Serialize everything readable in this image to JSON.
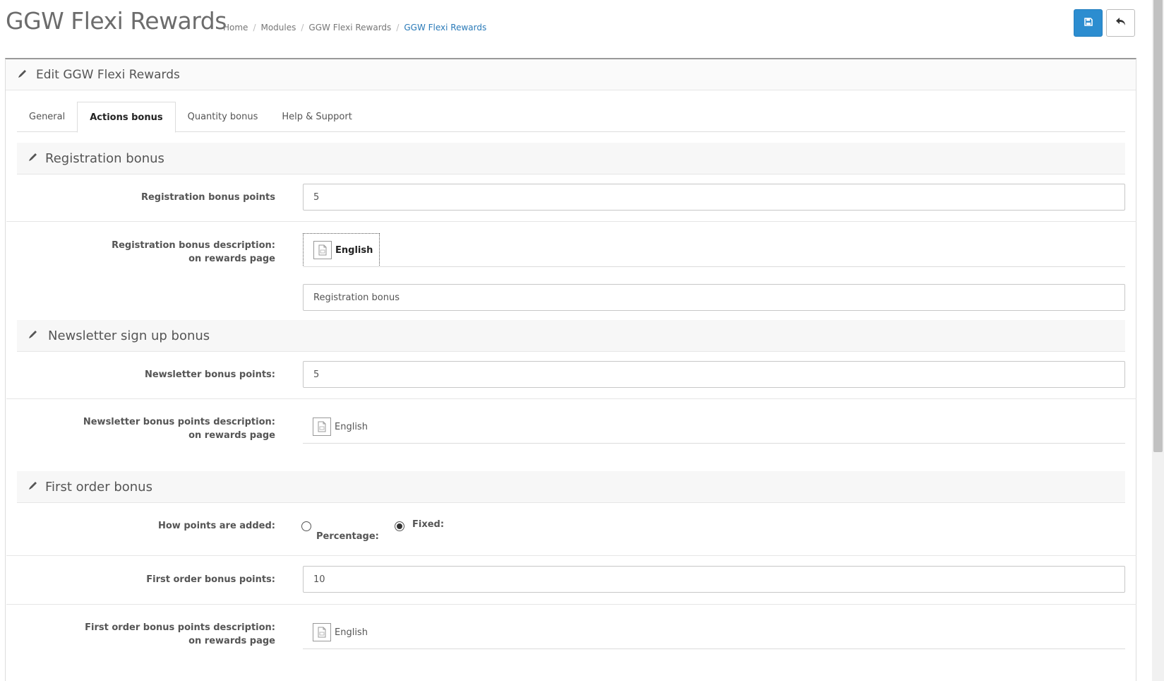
{
  "header": {
    "title": "GGW Flexi Rewards",
    "breadcrumbs": [
      "Home",
      "Modules",
      "GGW Flexi Rewards",
      "GGW Flexi Rewards"
    ]
  },
  "toolbar": {
    "save_icon": "save-icon",
    "back_icon": "back-icon"
  },
  "panel": {
    "heading": "Edit GGW Flexi Rewards",
    "tabs": [
      {
        "label": "General"
      },
      {
        "label": "Actions bonus"
      },
      {
        "label": "Quantity bonus"
      },
      {
        "label": "Help & Support"
      }
    ],
    "active_tab": "Actions bonus"
  },
  "registration": {
    "section_title": "Registration bonus",
    "points_label": "Registration bonus points",
    "points_value": "5",
    "desc_label_line1": "Registration bonus description:",
    "desc_label_line2": "on rewards page",
    "language": "English",
    "desc_value": "Registration bonus"
  },
  "newsletter": {
    "section_title": "Newsletter sign up bonus",
    "points_label": "Newsletter bonus points:",
    "points_value": "5",
    "desc_label_line1": "Newsletter bonus points description:",
    "desc_label_line2": "on rewards page",
    "language": "English"
  },
  "first_order": {
    "section_title": "First order bonus",
    "how_label": "How points are added:",
    "option_percentage": "Percentage:",
    "option_fixed": "Fixed:",
    "selected": "Fixed:",
    "points_label": "First order bonus points:",
    "points_value": "10",
    "desc_label_line1": "First order bonus points description:",
    "desc_label_line2": "on rewards page",
    "language": "English"
  },
  "colors": {
    "primary": "#2c8dd0",
    "breadcrumb_active": "#2a7ab8"
  }
}
